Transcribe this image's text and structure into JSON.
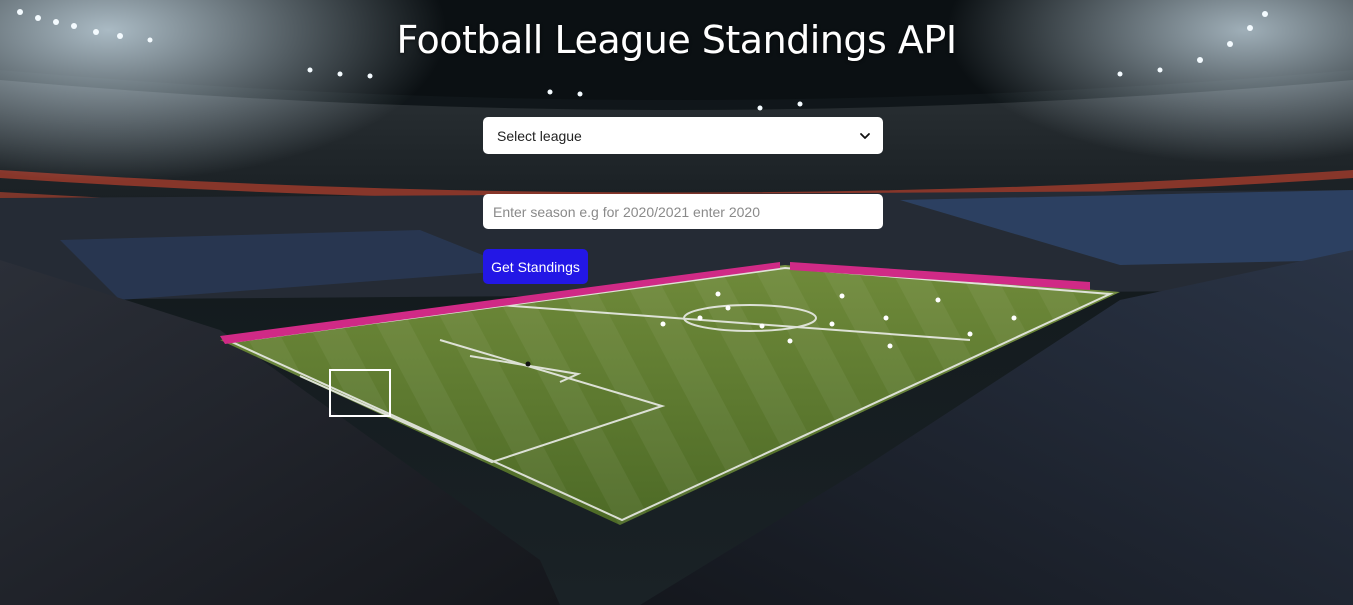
{
  "page": {
    "title": "Football League Standings API"
  },
  "form": {
    "league_select": {
      "selected": "Select league",
      "icon": "chevron-down-icon"
    },
    "season_input": {
      "value": "",
      "placeholder": "Enter season e.g for 2020/2021 enter 2020"
    },
    "submit_label": "Get Standings"
  },
  "colors": {
    "button": "#2317e6",
    "title": "#ffffff",
    "field_background": "#ffffff"
  }
}
